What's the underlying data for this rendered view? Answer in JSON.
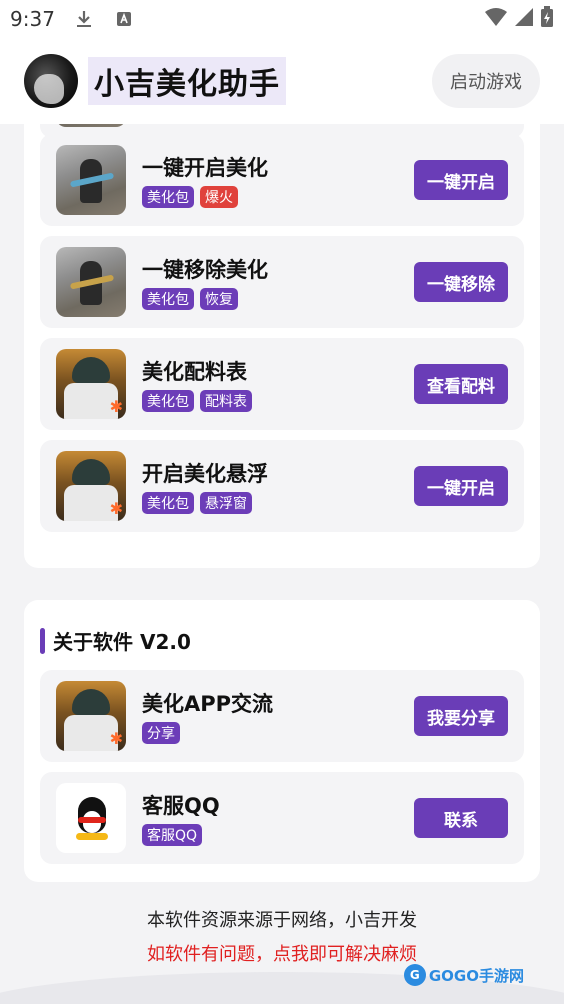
{
  "status_bar": {
    "time": "9:37",
    "icons": [
      "download-icon",
      "a-notification-icon",
      "wifi-icon",
      "signal-icon",
      "battery-icon"
    ]
  },
  "header": {
    "title": "小吉美化助手",
    "launch_button": "启动游戏"
  },
  "beautify_items": [
    {
      "title": "一键开启美化",
      "tags": [
        "美化包",
        "爆火"
      ],
      "action": "一键开启"
    },
    {
      "title": "一键移除美化",
      "tags": [
        "美化包",
        "恢复"
      ],
      "action": "一键移除"
    },
    {
      "title": "美化配料表",
      "tags": [
        "美化包",
        "配料表"
      ],
      "action": "查看配料"
    },
    {
      "title": "开启美化悬浮",
      "tags": [
        "美化包",
        "悬浮窗"
      ],
      "action": "一键开启"
    }
  ],
  "about": {
    "section_title": "关于软件 V2.0",
    "items": [
      {
        "title": "美化APP交流",
        "tags": [
          "分享"
        ],
        "action": "我要分享"
      },
      {
        "title": "客服QQ",
        "tags": [
          "客服QQ"
        ],
        "action": "联系"
      }
    ]
  },
  "footer": {
    "line1": "本软件资源来源于网络，小吉开发",
    "line2": "如软件有问题，点我即可解决麻烦"
  },
  "watermark": {
    "text": "GOGO手游网"
  },
  "colors": {
    "accent": "#6a3db7",
    "hot_tag": "#e0423c",
    "alert_text": "#e02020"
  }
}
